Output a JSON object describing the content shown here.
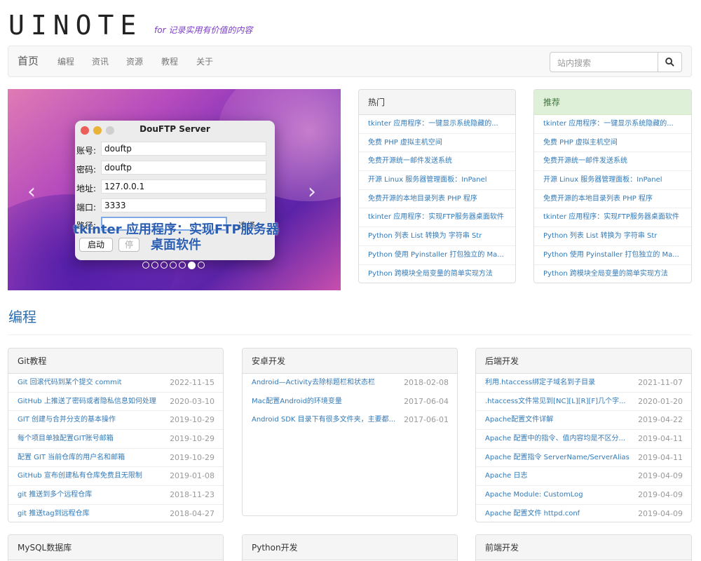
{
  "site": {
    "logo": "UINOTE",
    "tagline": "for 记录实用有价值的内容"
  },
  "nav": {
    "items": [
      "首页",
      "编程",
      "资讯",
      "资源",
      "教程",
      "关于"
    ],
    "search_placeholder": "站内搜索"
  },
  "carousel": {
    "window": {
      "title": "DouFTP Server",
      "fields": [
        {
          "label": "账号:",
          "value": "douftp"
        },
        {
          "label": "密码:",
          "value": "douftp"
        },
        {
          "label": "地址:",
          "value": "127.0.0.1"
        },
        {
          "label": "端口:",
          "value": "3333"
        },
        {
          "label": "路径:",
          "value": ""
        }
      ],
      "choose_label": "选择",
      "start_label": "启动",
      "stop_label": "停"
    },
    "caption": "tkinter 应用程序：实现FTP服务器桌面软件",
    "slide_count": 7,
    "active_slide": 6
  },
  "hot": {
    "title": "热门",
    "items": [
      "tkinter 应用程序：一键显示系统隐藏的...",
      "免费 PHP 虚拟主机空间",
      "免费开源统一邮件发送系统",
      "开源 Linux 服务器管理面板：InPanel",
      "免费开源的本地目录列表 PHP 程序",
      "tkinter 应用程序：实现FTP服务器桌面软件",
      "Python 列表 List 转换为 字符串 Str",
      "Python 使用 Pyinstaller 打包独立的 Ma...",
      "Python 跨模块全局变量的简单实现方法"
    ]
  },
  "recommend": {
    "title": "推荐",
    "items": [
      "tkinter 应用程序：一键显示系统隐藏的...",
      "免费 PHP 虚拟主机空间",
      "免费开源统一邮件发送系统",
      "开源 Linux 服务器管理面板：InPanel",
      "免费开源的本地目录列表 PHP 程序",
      "tkinter 应用程序：实现FTP服务器桌面软件",
      "Python 列表 List 转换为 字符串 Str",
      "Python 使用 Pyinstaller 打包独立的 Ma...",
      "Python 跨模块全局变量的简单实现方法"
    ]
  },
  "section": {
    "title": "编程"
  },
  "categories": [
    {
      "title": "Git教程",
      "items": [
        {
          "title": "Git 回滚代码到某个提交 commit",
          "date": "2022-11-15"
        },
        {
          "title": "GitHub 上推送了密码或者隐私信息如何处理",
          "date": "2020-03-10"
        },
        {
          "title": "GIT 创建与合并分支的基本操作",
          "date": "2019-10-29"
        },
        {
          "title": "每个项目单独配置GIT账号邮箱",
          "date": "2019-10-29"
        },
        {
          "title": "配置 GIT 当前仓库的用户名和邮箱",
          "date": "2019-10-29"
        },
        {
          "title": "GitHub 宣布创建私有仓库免费且无限制",
          "date": "2019-01-08"
        },
        {
          "title": "git 推送到多个远程仓库",
          "date": "2018-11-23"
        },
        {
          "title": "git 推送tag到远程仓库",
          "date": "2018-04-27"
        }
      ]
    },
    {
      "title": "安卓开发",
      "items": [
        {
          "title": "Android—Activity去除标题栏和状态栏",
          "date": "2018-02-08"
        },
        {
          "title": "Mac配置Android的环境变量",
          "date": "2017-06-04"
        },
        {
          "title": "Android SDK 目录下有很多文件夹，主要都...",
          "date": "2017-06-01"
        }
      ]
    },
    {
      "title": "后端开发",
      "items": [
        {
          "title": "利用.htaccess绑定子域名到子目录",
          "date": "2021-11-07"
        },
        {
          "title": ".htaccess文件常见到[NC][L][R][F]几个字...",
          "date": "2020-01-20"
        },
        {
          "title": "Apache配置文件详解",
          "date": "2019-04-22"
        },
        {
          "title": "Apache 配置中的指令、值内容均是不区分...",
          "date": "2019-04-11"
        },
        {
          "title": "Apache 配置指令 ServerName/ServerAlias",
          "date": "2019-04-11"
        },
        {
          "title": "Apache 日志",
          "date": "2019-04-09"
        },
        {
          "title": "Apache Module: CustomLog",
          "date": "2019-04-09"
        },
        {
          "title": "Apache 配置文件 httpd.conf",
          "date": "2019-04-09"
        }
      ]
    },
    {
      "title": "MySQL数据库",
      "items": []
    },
    {
      "title": "Python开发",
      "items": []
    },
    {
      "title": "前端开发",
      "items": []
    }
  ],
  "colors": {
    "link": "#337ab7",
    "accent": "#2a6db0",
    "tagline": "#7b3fc4",
    "recommend_head": "#dff0d8"
  }
}
